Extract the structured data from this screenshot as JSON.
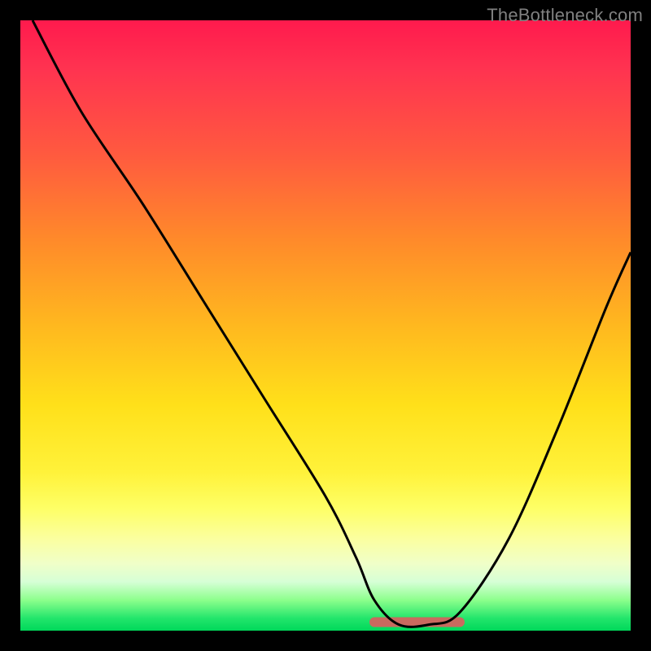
{
  "watermark": "TheBottleneck.com",
  "chart_data": {
    "type": "line",
    "title": "",
    "xlabel": "",
    "ylabel": "",
    "xlim": [
      0,
      100
    ],
    "ylim": [
      0,
      100
    ],
    "grid": false,
    "legend": false,
    "gradient_stops": [
      {
        "pos": 0,
        "color": "#ff1a4d"
      },
      {
        "pos": 50,
        "color": "#ffe01a"
      },
      {
        "pos": 85,
        "color": "#fbffa0"
      },
      {
        "pos": 100,
        "color": "#00d85a"
      }
    ],
    "series": [
      {
        "name": "bottleneck-curve",
        "x": [
          2,
          10,
          20,
          30,
          40,
          50,
          55,
          58,
          62,
          67,
          72,
          80,
          88,
          96,
          100
        ],
        "y": [
          100,
          85,
          70,
          54,
          38,
          22,
          12,
          5,
          1,
          1,
          3,
          15,
          33,
          53,
          62
        ]
      }
    ],
    "optimum_band": {
      "x_start": 58,
      "x_end": 72,
      "y": 1
    },
    "optimum_color": "#c96a5f"
  }
}
